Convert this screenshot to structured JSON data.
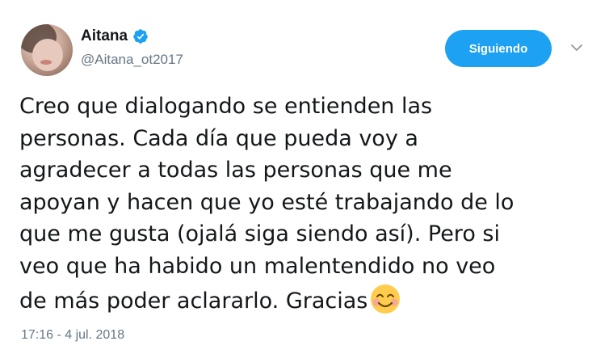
{
  "author": {
    "display_name": "Aitana",
    "handle": "@Aitana_ot2017",
    "verified": true,
    "avatar_icon": "avatar-photo"
  },
  "follow_button": {
    "label": "Siguiendo"
  },
  "menu": {
    "icon": "chevron-down-icon"
  },
  "tweet": {
    "text": "Creo que dialogando se entienden las\npersonas. Cada día que pueda voy a\nagradecer a todas las personas que me\napoyan y hacen que yo esté trabajando de lo\nque me gusta (ojalá siga siendo así). Pero si\nveo que ha habido un malentendido no veo\nde más poder aclararlo. Gracias",
    "emoji": "smiling-face-with-smiling-eyes",
    "timestamp": "17:16 - 4 jul. 2018"
  },
  "colors": {
    "accent": "#1da1f2",
    "text": "#14171a",
    "secondary_text": "#657786"
  }
}
